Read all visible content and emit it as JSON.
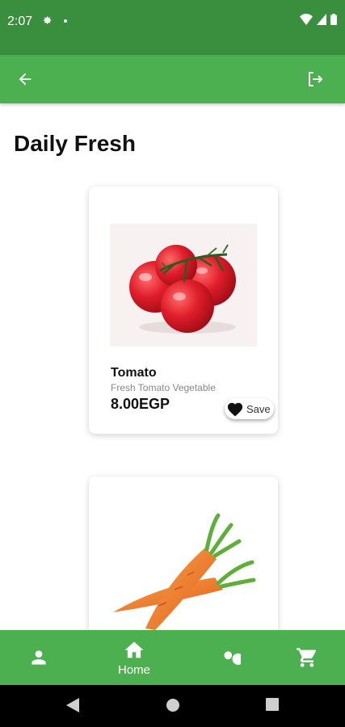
{
  "status_bar": {
    "time": "2:07"
  },
  "page": {
    "title": "Daily Fresh"
  },
  "products": [
    {
      "name": "Tomato",
      "description": "Fresh Tomato Vegetable",
      "price": "8.00EGP",
      "save_label": "Save"
    },
    {
      "name": "Carrot"
    }
  ],
  "bottom_nav": {
    "home_label": "Home"
  },
  "colors": {
    "status_bar": "#3a8f3f",
    "app_bar": "#4caf50",
    "accent": "#4caf50"
  },
  "icons": {
    "app_bar": [
      "back-arrow-icon",
      "logout-icon"
    ],
    "bottom_nav": [
      "person-icon",
      "home-icon",
      "search-icon",
      "cart-icon"
    ]
  }
}
